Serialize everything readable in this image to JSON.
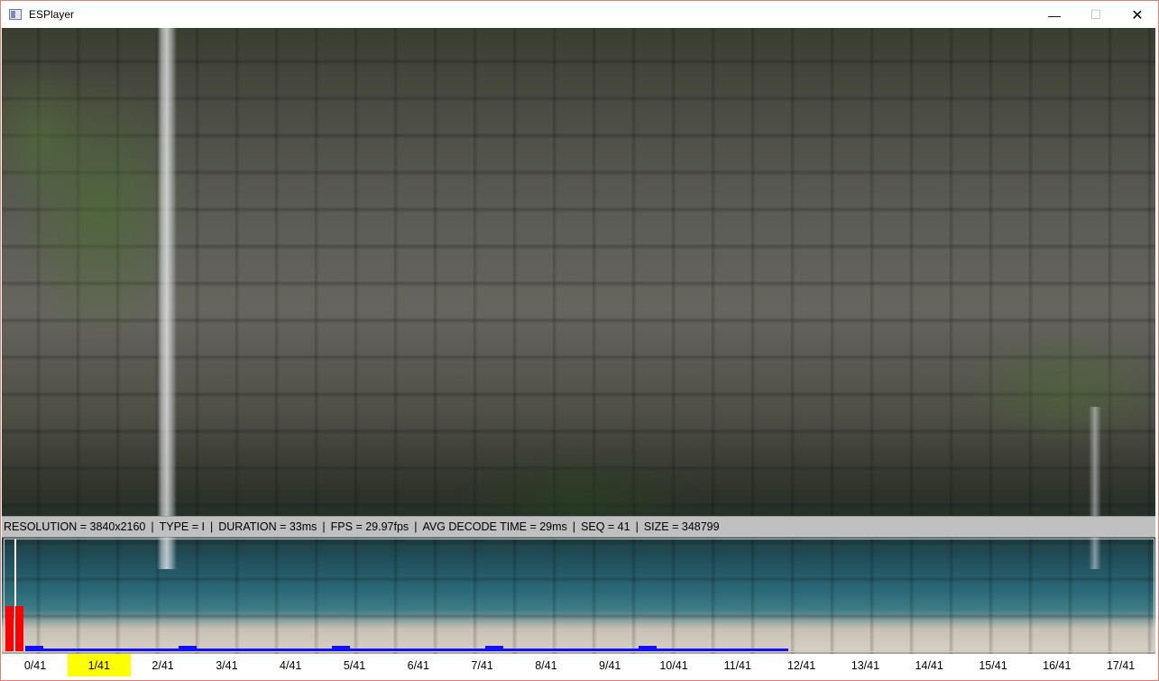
{
  "window": {
    "title": "ESPlayer",
    "buttons": {
      "minimize": "—",
      "maximize": "☐",
      "close": "✕"
    }
  },
  "info": {
    "resolution": "RESOLUTION = 3840x2160",
    "type": "TYPE = I",
    "duration": "DURATION = 33ms",
    "fps": "FPS = 29.97fps",
    "avg_decode": "AVG DECODE TIME = 29ms",
    "seq": "SEQ = 41",
    "size": "SIZE = 348799",
    "separator": "|"
  },
  "timeline": {
    "labels": [
      "0/41",
      "1/41",
      "2/41",
      "3/41",
      "4/41",
      "5/41",
      "6/41",
      "7/41",
      "8/41",
      "9/41",
      "10/41",
      "11/41",
      "12/41",
      "13/41",
      "14/41",
      "15/41",
      "16/41",
      "17/41"
    ],
    "current_index": 1,
    "colors": {
      "i_frame": "#ff0000",
      "p_frame": "#1010ff",
      "highlight": "#ffff00"
    }
  },
  "frame_bars": {
    "i_frame_heights": [
      1.0,
      1.0
    ],
    "p_frame_peaks": [
      0.12,
      0.12,
      0.12,
      0.12,
      0.12
    ]
  }
}
